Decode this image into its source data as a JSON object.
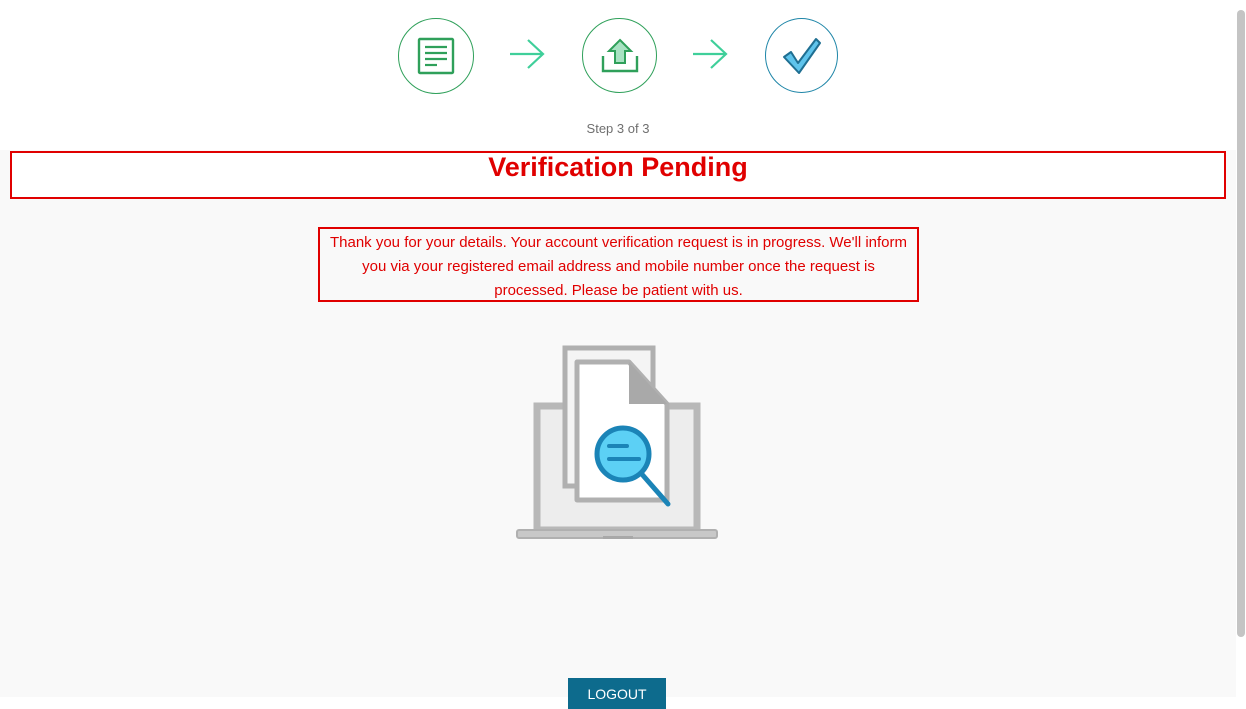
{
  "stepper": {
    "steps": [
      {
        "icon": "document-form-icon",
        "status": "completed"
      },
      {
        "icon": "upload-icon",
        "status": "completed"
      },
      {
        "icon": "checkmark-icon",
        "status": "active"
      }
    ],
    "counter_text": "Step 3 of 3"
  },
  "status": {
    "title": "Verification Pending",
    "message": "Thank you for your details. Your account verification request is in progress. We'll inform you via your registered email address and mobile number once the request is processed. Please be patient with us."
  },
  "illustration": {
    "icon": "document-review-laptop-icon"
  },
  "actions": {
    "logout_label": "LOGOUT"
  },
  "colors": {
    "alert_red": "#e00000",
    "step_green": "#2fa05a",
    "arrow_green": "#3fcf9a",
    "active_blue": "#1f86a8",
    "button_blue": "#0d6b8d"
  }
}
